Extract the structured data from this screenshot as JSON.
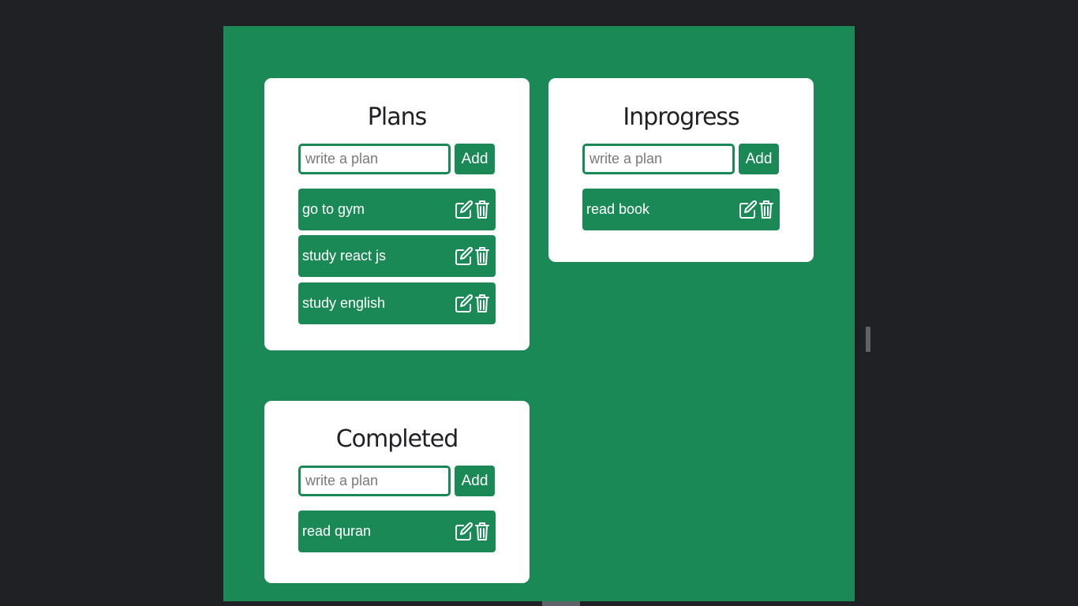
{
  "columns": [
    {
      "title": "Plans",
      "input": {
        "placeholder": "write a plan",
        "value": ""
      },
      "add_label": "Add",
      "tasks": [
        "go to gym",
        "study react js",
        "study english"
      ]
    },
    {
      "title": "Inprogress",
      "input": {
        "placeholder": "write a plan",
        "value": ""
      },
      "add_label": "Add",
      "tasks": [
        "read book"
      ]
    },
    {
      "title": "Completed",
      "input": {
        "placeholder": "write a plan",
        "value": ""
      },
      "add_label": "Add",
      "tasks": [
        "read quran"
      ]
    }
  ],
  "icons": {
    "edit": "edit-icon",
    "delete": "trash-icon"
  },
  "colors": {
    "accent": "#1a8956",
    "card": "#ffffff",
    "background": "#202124",
    "title_text": "#202124"
  }
}
